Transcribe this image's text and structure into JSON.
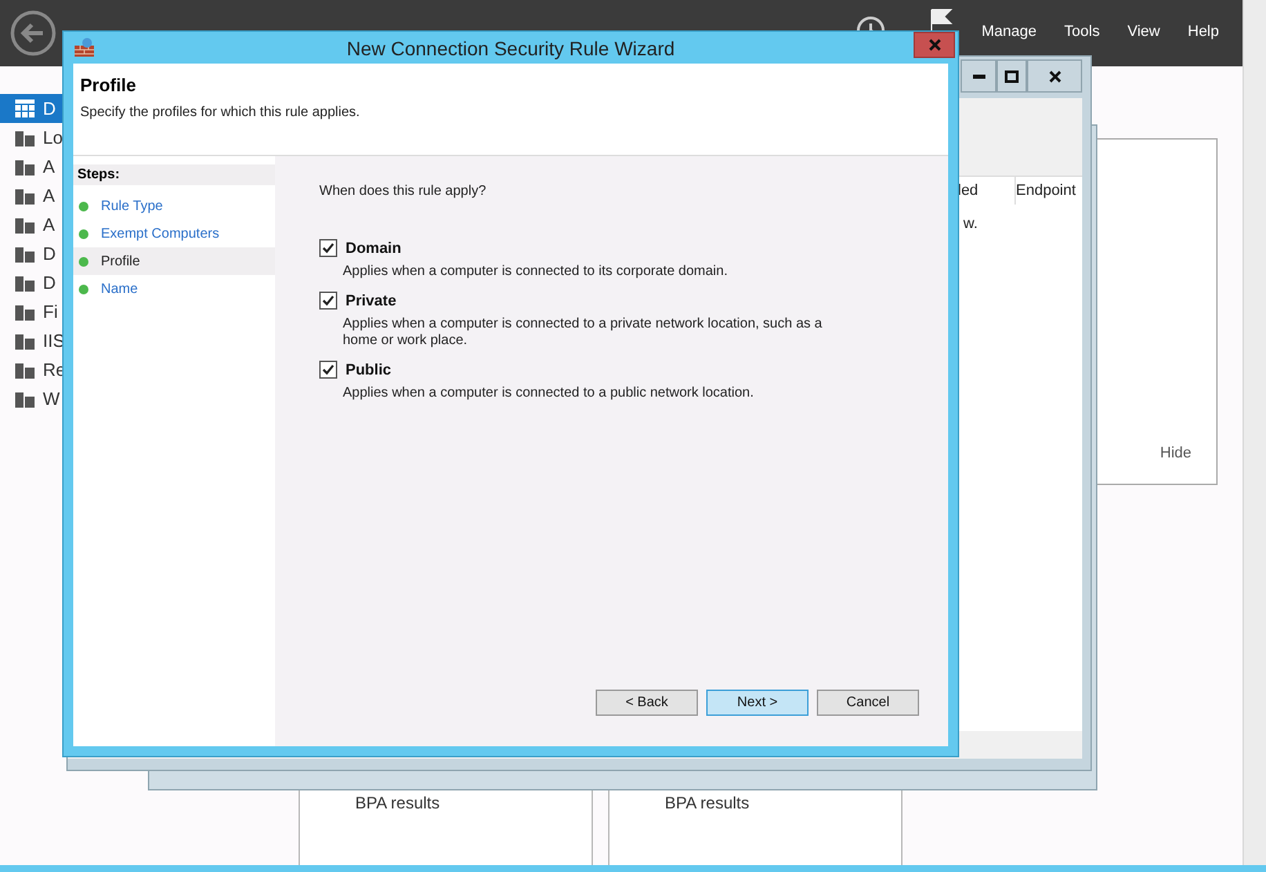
{
  "server_manager": {
    "menu": [
      "Manage",
      "Tools",
      "View",
      "Help"
    ],
    "sidebar": [
      {
        "label": "D",
        "selected": true
      },
      {
        "label": "Lo",
        "selected": false
      },
      {
        "label": "A",
        "selected": false
      },
      {
        "label": "A",
        "selected": false
      },
      {
        "label": "A",
        "selected": false
      },
      {
        "label": "D",
        "selected": false
      },
      {
        "label": "D",
        "selected": false
      },
      {
        "label": "Fi",
        "selected": false
      },
      {
        "label": "IIS",
        "selected": false
      },
      {
        "label": "Re",
        "selected": false
      },
      {
        "label": "W",
        "selected": false
      }
    ],
    "hide_link": "Hide",
    "tiles": [
      {
        "label": "BPA results"
      },
      {
        "label": "BPA results"
      }
    ]
  },
  "background_window": {
    "columns": [
      "led",
      "Endpoint"
    ],
    "message": "w."
  },
  "wizard": {
    "title": "New Connection Security Rule Wizard",
    "page_title": "Profile",
    "page_subtitle": "Specify the profiles for which this rule applies.",
    "steps_label": "Steps:",
    "steps": [
      {
        "label": "Rule Type",
        "selected": false
      },
      {
        "label": "Exempt Computers",
        "selected": false
      },
      {
        "label": "Profile",
        "selected": true
      },
      {
        "label": "Name",
        "selected": false
      }
    ],
    "question": "When does this rule apply?",
    "options": [
      {
        "label": "Domain",
        "description": "Applies when a computer is connected to its corporate domain.",
        "checked": true
      },
      {
        "label": "Private",
        "description": "Applies when a computer is connected to a private network location, such as a home or work place.",
        "checked": true
      },
      {
        "label": "Public",
        "description": "Applies when a computer is connected to a public network location.",
        "checked": true
      }
    ],
    "buttons": [
      {
        "label": "< Back",
        "kind": "normal"
      },
      {
        "label": "Next >",
        "kind": "focused"
      },
      {
        "label": "Cancel",
        "kind": "normal"
      }
    ]
  }
}
